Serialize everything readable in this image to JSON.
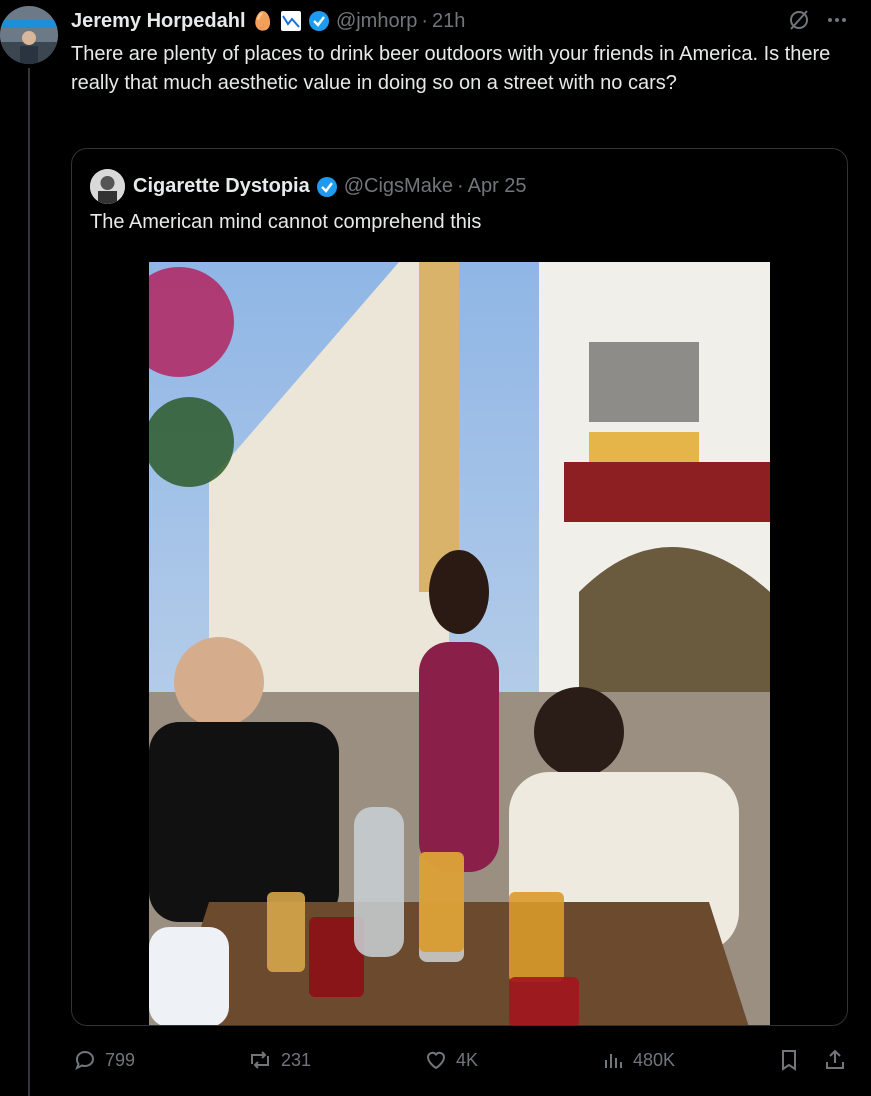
{
  "tweet": {
    "author_name": "Jeremy Horpedahl",
    "author_emoji": "🥚",
    "handle": "@jmhorp",
    "separator": "·",
    "time": "21h",
    "text": "There are plenty of places to drink beer outdoors with your friends in America. Is there really that much aesthetic value in doing so on a street with no cars?"
  },
  "quote": {
    "author_name": "Cigarette Dystopia",
    "handle": "@CigsMake",
    "separator": "·",
    "date": "Apr 25",
    "text": "The American mind cannot comprehend this"
  },
  "actions": {
    "replies": "799",
    "reposts": "231",
    "likes": "4K",
    "views": "480K"
  },
  "colors": {
    "background": "#000000",
    "text": "#e7e9ea",
    "muted": "#71767b",
    "verified": "#1d9bf0",
    "border": "#2f3336"
  },
  "icons": [
    "verified-badge-icon",
    "grok-icon",
    "more-icon",
    "reply-icon",
    "repost-icon",
    "like-icon",
    "views-icon",
    "bookmark-icon",
    "share-icon"
  ]
}
